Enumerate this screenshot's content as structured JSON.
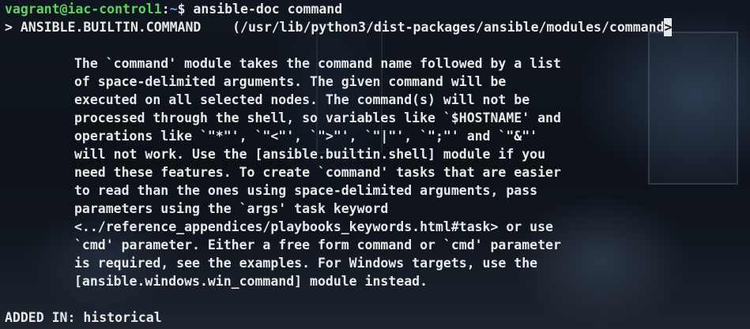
{
  "prompt": {
    "user_host": "vagrant@iac-control1",
    "colon": ":",
    "path": "~",
    "symbol": "$",
    "command": " ansible-doc command"
  },
  "header_line": "> ANSIBLE.BUILTIN.COMMAND    (/usr/lib/python3/dist-packages/ansible/modules/command",
  "overflow_marker": ">",
  "description_lines": [
    "The `command' module takes the command name followed by a list",
    "of space-delimited arguments. The given command will be",
    "executed on all selected nodes. The command(s) will not be",
    "processed through the shell, so variables like `$HOSTNAME' and",
    "operations like `\"*\"', `\"<\"', `\">\"', `\"|\"', `\";\"' and `\"&\"'",
    "will not work. Use the [ansible.builtin.shell] module if you",
    "need these features. To create `command' tasks that are easier",
    "to read than the ones using space-delimited arguments, pass",
    "parameters using the `args' task keyword",
    "<../reference_appendices/playbooks_keywords.html#task> or use",
    "`cmd' parameter. Either a free form command or `cmd' parameter",
    "is required, see the examples. For Windows targets, use the",
    "[ansible.windows.win_command] module instead."
  ],
  "added_in": "ADDED IN: historical",
  "colors": {
    "user_host": "#5fd35f",
    "path": "#6a9cff",
    "text": "#e8e8e8"
  }
}
